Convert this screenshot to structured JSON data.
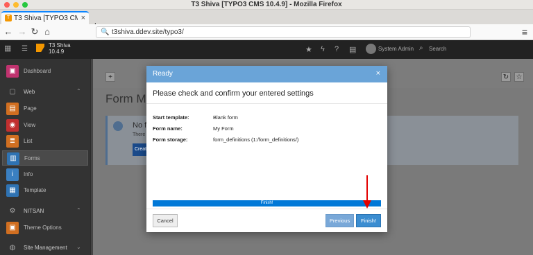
{
  "window": {
    "title": "T3 Shiva [TYPO3 CMS 10.4.9] - Mozilla Firefox",
    "traffic_colors": [
      "#fd5f57",
      "#febc2e",
      "#28c840"
    ]
  },
  "browser": {
    "tab_label": "T3 Shiva [TYPO3 CMS 10.4.9]",
    "tab_close": "×",
    "newtab": "+",
    "url": "t3shiva.ddev.site/typo3/",
    "menu_icon": "≡"
  },
  "topbar": {
    "site_name": "T3 Shiva",
    "version": "10.4.9",
    "user": "System Admin",
    "search_placeholder": "Search"
  },
  "sidebar": {
    "items": [
      {
        "label": "Dashboard",
        "type": "item",
        "icon": "dashboard-icon",
        "color": "#c0336f"
      },
      {
        "label": "Web",
        "type": "group",
        "icon": "file-icon"
      },
      {
        "label": "Page",
        "type": "item",
        "icon": "page-icon",
        "color": "#d16f21"
      },
      {
        "label": "View",
        "type": "item",
        "icon": "eye-icon",
        "color": "#c12f2f"
      },
      {
        "label": "List",
        "type": "item",
        "icon": "list-icon",
        "color": "#d16f21"
      },
      {
        "label": "Forms",
        "type": "item",
        "icon": "forms-icon",
        "color": "#2f73b3",
        "active": true
      },
      {
        "label": "Info",
        "type": "item",
        "icon": "info-icon",
        "color": "#3a7fc1"
      },
      {
        "label": "Template",
        "type": "item",
        "icon": "template-icon",
        "color": "#2f73b3"
      },
      {
        "label": "NITSAN",
        "type": "group",
        "icon": "gear-icon"
      },
      {
        "label": "Theme Options",
        "type": "item",
        "icon": "theme-icon",
        "color": "#d16f21"
      },
      {
        "label": "Site Management",
        "type": "group",
        "icon": "globe-icon"
      }
    ]
  },
  "module": {
    "title": "Form Ma",
    "info_title": "No fo",
    "info_text": "There",
    "info_button": "Create"
  },
  "modal": {
    "title": "Ready",
    "heading": "Please check and confirm your entered settings",
    "rows": [
      {
        "key": "Start template:",
        "value": "Blank form"
      },
      {
        "key": "Form name:",
        "value": "My Form"
      },
      {
        "key": "Form storage:",
        "value": "form_definitions (1:/form_definitions/)"
      }
    ],
    "progress_label": "Finish!",
    "progress": 1.0,
    "buttons": {
      "cancel": "Cancel",
      "previous": "Previous",
      "finish": "Finish!"
    },
    "close": "×"
  },
  "annotation": {
    "color": "#e30000",
    "icon": "red-arrow-icon"
  }
}
